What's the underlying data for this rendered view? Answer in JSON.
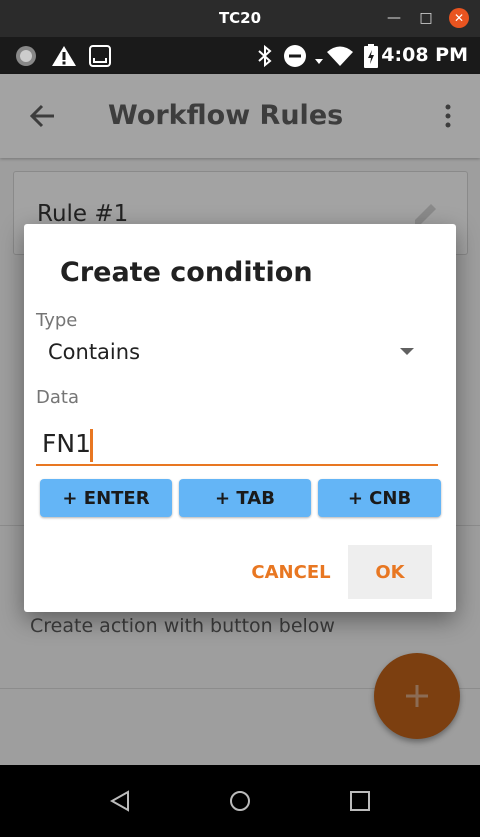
{
  "window": {
    "title": "TC20"
  },
  "status": {
    "time": "4:08 PM"
  },
  "appbar": {
    "title": "Workflow Rules"
  },
  "rule": {
    "label": "Rule #1"
  },
  "hint": "Create action with button below",
  "dialog": {
    "title": "Create condition",
    "type_label": "Type",
    "type_value": "Contains",
    "data_label": "Data",
    "data_value": "FN1",
    "buttons": {
      "enter": "+ ENTER",
      "tab": "+ TAB",
      "cnb": "+ CNB"
    },
    "cancel": "CANCEL",
    "ok": "OK"
  },
  "colors": {
    "accent": "#e87722",
    "quick_button": "#64b5f6",
    "fab": "#7c3f10"
  }
}
